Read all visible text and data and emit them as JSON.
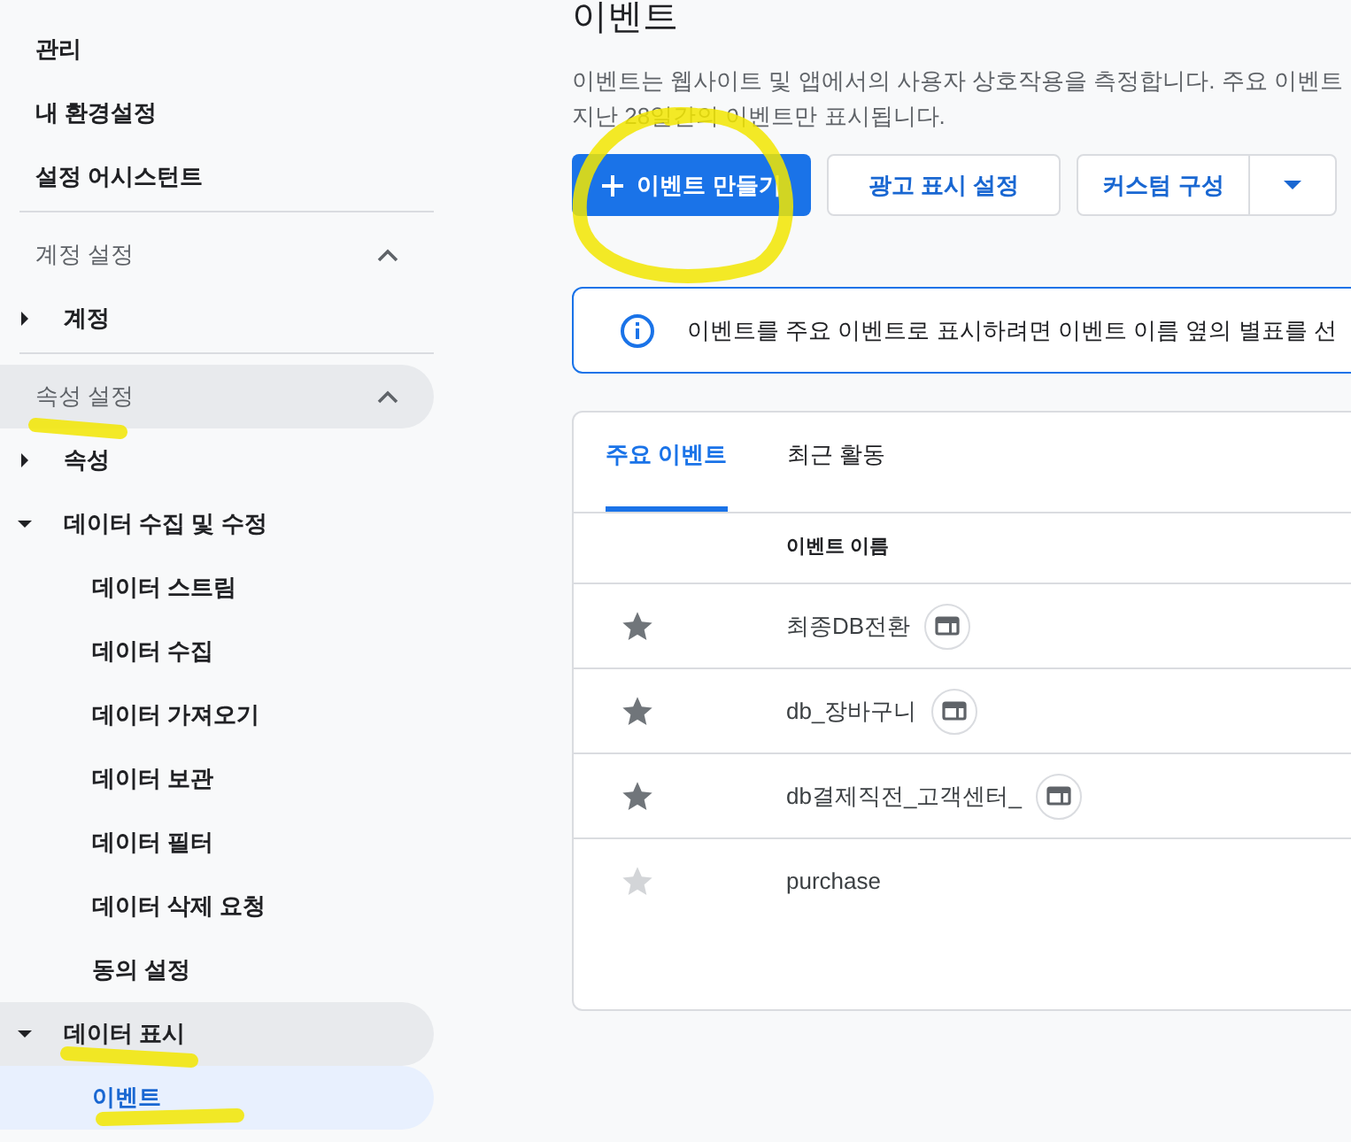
{
  "sidebar": {
    "links": [
      "관리",
      "내 환경설정",
      "설정 어시스턴트"
    ],
    "sections": [
      {
        "title": "계정 설정",
        "expanded": true,
        "highlighted": false,
        "items": [
          {
            "label": "계정",
            "expanded": false,
            "highlighted": false
          }
        ]
      },
      {
        "title": "속성 설정",
        "expanded": true,
        "highlighted": true,
        "items": [
          {
            "label": "속성",
            "expanded": false,
            "highlighted": false
          },
          {
            "label": "데이터 수집 및 수정",
            "expanded": true,
            "highlighted": false,
            "children": [
              {
                "label": "데이터 스트림",
                "selected": false
              },
              {
                "label": "데이터 수집",
                "selected": false
              },
              {
                "label": "데이터 가져오기",
                "selected": false
              },
              {
                "label": "데이터 보관",
                "selected": false
              },
              {
                "label": "데이터 필터",
                "selected": false
              },
              {
                "label": "데이터 삭제 요청",
                "selected": false
              },
              {
                "label": "동의 설정",
                "selected": false
              }
            ]
          },
          {
            "label": "데이터 표시",
            "expanded": true,
            "highlighted": true,
            "children": [
              {
                "label": "이벤트",
                "selected": true
              }
            ]
          }
        ]
      }
    ]
  },
  "page": {
    "title": "이벤트",
    "description": [
      "이벤트는 웹사이트 및 앱에서의 사용자 상호작용을 측정합니다. 주요 이벤트",
      "지난 28일간의 이벤트만 표시됩니다."
    ],
    "buttons": {
      "create": "이벤트 만들기",
      "ad_settings": "광고 표시 설정",
      "custom": "커스텀 구성"
    },
    "info": "이벤트를 주요 이벤트로 표시하려면 이벤트 이름 옆의 별표를 선"
  },
  "card": {
    "tabs": [
      {
        "label": "주요 이벤트",
        "selected": true
      },
      {
        "label": "최근 활동",
        "selected": false
      }
    ],
    "columns": [
      "이벤트 이름"
    ],
    "rows": [
      {
        "name": "최종DB전환",
        "starred": true
      },
      {
        "name": "db_장바구니",
        "starred": true
      },
      {
        "name": "db결제직전_고객센터_",
        "starred": true
      },
      {
        "name": "purchase",
        "starred": false
      }
    ]
  }
}
